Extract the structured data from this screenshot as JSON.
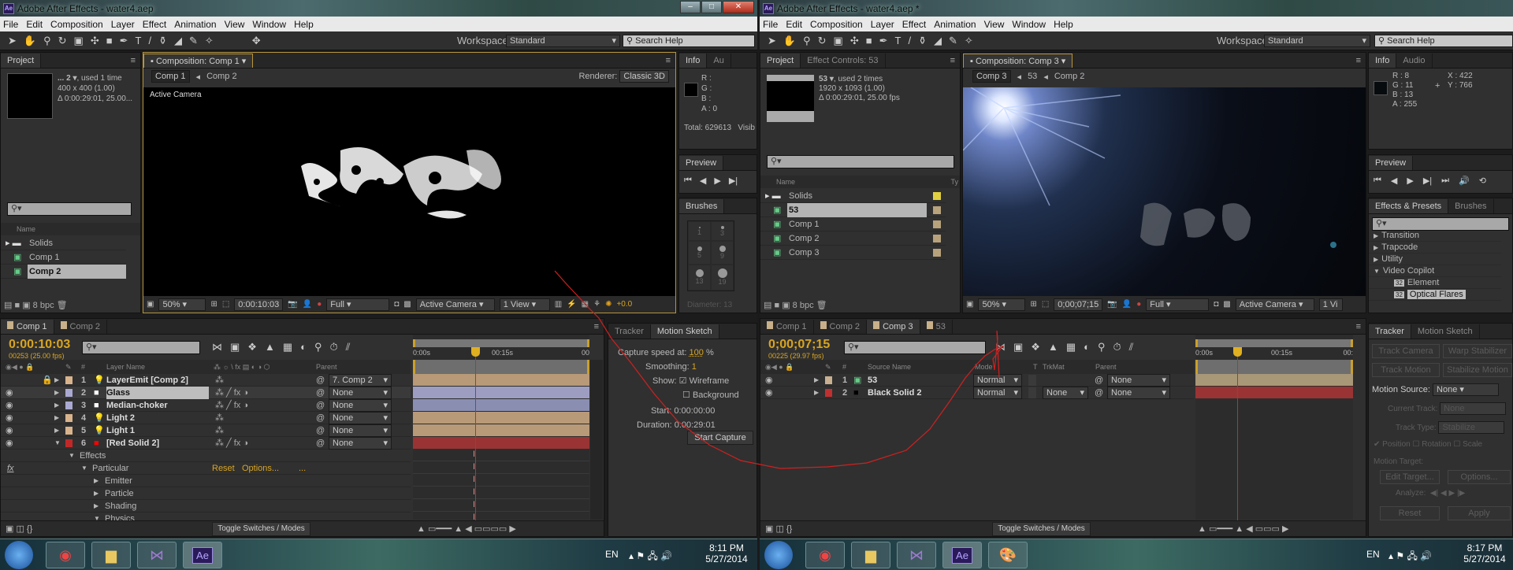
{
  "left": {
    "title": "Adobe After Effects - water4.aep",
    "app_icon": "Ae",
    "menu": [
      "File",
      "Edit",
      "Composition",
      "Layer",
      "Effect",
      "Animation",
      "View",
      "Window",
      "Help"
    ],
    "workspace_label": "Workspace:",
    "workspace": "Standard",
    "search_help": "Search Help",
    "project": {
      "tab": "Project",
      "item_name": "... 2 ▾",
      "item_used": ", used 1 time",
      "item_dims": "400 x 400 (1.00)",
      "item_duration": "Δ 0:00:29:01, 25.00...",
      "col_name": "Name",
      "items": [
        {
          "name": "Solids",
          "type": "folder"
        },
        {
          "name": "Comp 1",
          "type": "comp"
        },
        {
          "name": "Comp 2",
          "type": "comp",
          "selected": true
        }
      ],
      "bpc": "8 bpc"
    },
    "comp": {
      "tab": "Composition: Comp 1",
      "breadcrumbs": [
        "Comp 1",
        "Comp 2"
      ],
      "renderer_label": "Renderer:",
      "renderer": "Classic 3D",
      "viewer_label": "Active Camera",
      "zoom": "50%",
      "timecode": "0:00:10:03",
      "resolution": "Full",
      "camera": "Active Camera",
      "views": "1 View",
      "exposure": "+0.0"
    },
    "info": {
      "tab": "Info",
      "tab2": "Au",
      "r": "R :",
      "g": "G :",
      "b": "B :",
      "a": "A : 0",
      "total": "Total: 629613",
      "visible": "Visib"
    },
    "preview": {
      "tab": "Preview"
    },
    "brushes": {
      "tab": "Brushes",
      "sizes": [
        "1",
        "3",
        "5",
        "9",
        "13",
        "19"
      ],
      "diameter": "Diameter: 13"
    },
    "timeline": {
      "tabs": [
        "Comp 1",
        "Comp 2"
      ],
      "timecode": "0:00:10:03",
      "fps": "00253 (25.00 fps)",
      "ruler": [
        "0:00s",
        "00:15s",
        "00"
      ],
      "col_num": "#",
      "col_name": "Layer Name",
      "col_parent": "Parent",
      "layers": [
        {
          "num": "1",
          "name": "LayerEmit [Comp 2]",
          "label": "#d9b38c",
          "kind": "light",
          "parent": "7. Comp 2",
          "bar": "#b89a78",
          "locked": true
        },
        {
          "num": "2",
          "name": "Glass",
          "label": "#a9a9d2",
          "kind": "solid-white",
          "parent": "None",
          "bar": "#9d9dc2",
          "selected": true,
          "fx": true
        },
        {
          "num": "3",
          "name": "Median-choker",
          "label": "#a9a9d2",
          "kind": "solid-white",
          "parent": "None",
          "bar": "#8a8fb2",
          "fx": true
        },
        {
          "num": "4",
          "name": "Light 2",
          "label": "#d9b38c",
          "kind": "light",
          "parent": "None",
          "bar": "#b89a78"
        },
        {
          "num": "5",
          "name": "Light 1",
          "label": "#d9b38c",
          "kind": "light",
          "parent": "None",
          "bar": "#b89a78"
        },
        {
          "num": "6",
          "name": "[Red Solid 2]",
          "label": "#c02828",
          "kind": "solid-red",
          "parent": "None",
          "bar": "#9a3434",
          "fx": true,
          "expanded": true
        }
      ],
      "effects": [
        {
          "name": "Effects",
          "indent": 1,
          "open": true
        },
        {
          "name": "Particular",
          "indent": 2,
          "open": true,
          "fx": true,
          "reset": "Reset",
          "options": "Options...",
          "more": "..."
        },
        {
          "name": "Emitter",
          "indent": 3,
          "open": false
        },
        {
          "name": "Particle",
          "indent": 3,
          "open": false
        },
        {
          "name": "Shading",
          "indent": 3,
          "open": false
        },
        {
          "name": "Physics",
          "indent": 3,
          "open": true
        }
      ],
      "toggle": "Toggle Switches / Modes"
    },
    "motion_sketch": {
      "tabs": [
        "Tracker",
        "Motion Sketch"
      ],
      "capture_label": "Capture speed at:",
      "capture": "100",
      "capture_unit": "%",
      "smoothing_label": "Smoothing:",
      "smoothing": "1",
      "show_label": "Show:",
      "wireframe": "Wireframe",
      "wireframe_checked": true,
      "background": "Background",
      "background_checked": false,
      "start_label": "Start:",
      "start": "0:00:00:00",
      "duration_label": "Duration:",
      "duration": "0:00:29:01",
      "button": "Start Capture"
    },
    "taskbar": {
      "lang": "EN",
      "time": "8:11 PM",
      "date": "5/27/2014"
    }
  },
  "right": {
    "title": "Adobe After Effects - water4.aep *",
    "app_icon": "Ae",
    "menu": [
      "File",
      "Edit",
      "Composition",
      "Layer",
      "Effect",
      "Animation",
      "View",
      "Window",
      "Help"
    ],
    "workspace_label": "Workspace:",
    "workspace": "Standard",
    "search_help": "Search Help",
    "project": {
      "tab": "Project",
      "tab2": "Effect Controls: 53",
      "item_name": "53 ▾",
      "item_used": ", used 2 times",
      "item_dims": "1920 x 1093 (1.00)",
      "item_duration": "Δ 0:00:29:01, 25.00 fps",
      "col_name": "Name",
      "col_type": "Ty",
      "items": [
        {
          "name": "Solids",
          "type": "folder",
          "label": "#e0d040"
        },
        {
          "name": "53",
          "type": "comp",
          "selected": true,
          "label": "#b8a27c"
        },
        {
          "name": "Comp 1",
          "type": "comp",
          "label": "#b8a27c"
        },
        {
          "name": "Comp 2",
          "type": "comp",
          "label": "#b8a27c"
        },
        {
          "name": "Comp 3",
          "type": "comp",
          "label": "#b8a27c"
        }
      ],
      "bpc": "8 bpc"
    },
    "comp": {
      "tab": "Composition: Comp 3",
      "breadcrumbs": [
        "Comp 3",
        "53",
        "Comp 2"
      ],
      "zoom": "50%",
      "timecode": "0;00;07;15",
      "resolution": "Full",
      "camera": "Active Camera",
      "views": "1 Vi"
    },
    "info": {
      "tab": "Info",
      "tab2": "Audio",
      "r": "R : 8",
      "g": "G : 11",
      "b": "B : 13",
      "a": "A : 255",
      "x": "X : 422",
      "y": "Y : 766"
    },
    "preview": {
      "tab": "Preview"
    },
    "effects_presets": {
      "tab": "Effects & Presets",
      "tab2": "Brushes",
      "items": [
        {
          "name": "Transition",
          "indent": 0,
          "open": false
        },
        {
          "name": "Trapcode",
          "indent": 0,
          "open": false
        },
        {
          "name": "Utility",
          "indent": 0,
          "open": false
        },
        {
          "name": "Video Copilot",
          "indent": 0,
          "open": true
        },
        {
          "name": "Element",
          "indent": 1,
          "plugin": true
        },
        {
          "name": "Optical Flares",
          "indent": 1,
          "plugin": true,
          "selected": true
        }
      ]
    },
    "timeline": {
      "tabs": [
        "Comp 1",
        "Comp 2",
        "Comp 3",
        "53"
      ],
      "active_tab": 2,
      "timecode": "0;00;07;15",
      "fps": "00225 (29.97 fps)",
      "ruler": [
        "0:00s",
        "00:15s",
        "00:"
      ],
      "col_num": "#",
      "col_name": "Source Name",
      "col_mode": "Mode",
      "col_t": "T",
      "col_trkmat": "TrkMat",
      "col_parent": "Parent",
      "layers": [
        {
          "num": "1",
          "name": "53",
          "label": "#c8b090",
          "kind": "comp",
          "mode": "Normal",
          "trkmat": "",
          "parent": "None",
          "bar": "#a89878"
        },
        {
          "num": "2",
          "name": "Black Solid 2",
          "label": "#c03030",
          "kind": "solid-black",
          "mode": "Normal",
          "trkmat": "None",
          "parent": "None",
          "bar": "#9a3434"
        }
      ],
      "toggle": "Toggle Switches / Modes"
    },
    "tracker": {
      "tabs": [
        "Tracker",
        "Motion Sketch"
      ],
      "track_camera": "Track Camera",
      "warp_stabilizer": "Warp Stabilizer",
      "track_motion": "Track Motion",
      "stabilize_motion": "Stabilize Motion",
      "motion_source_label": "Motion Source:",
      "motion_source": "None",
      "current_track_label": "Current Track:",
      "current_track": "None",
      "track_type_label": "Track Type:",
      "track_type": "Stabilize",
      "position": "Position",
      "rotation": "Rotation",
      "scale": "Scale",
      "motion_target_label": "Motion Target:",
      "edit_target": "Edit Target...",
      "options": "Options...",
      "analyze_label": "Analyze:",
      "reset": "Reset",
      "apply": "Apply"
    },
    "taskbar": {
      "lang": "EN",
      "time": "8:17 PM",
      "date": "5/27/2014"
    }
  },
  "colors": {
    "accent": "#d9a520",
    "playhead": "#e02020",
    "comp_border": "#b7953c"
  }
}
